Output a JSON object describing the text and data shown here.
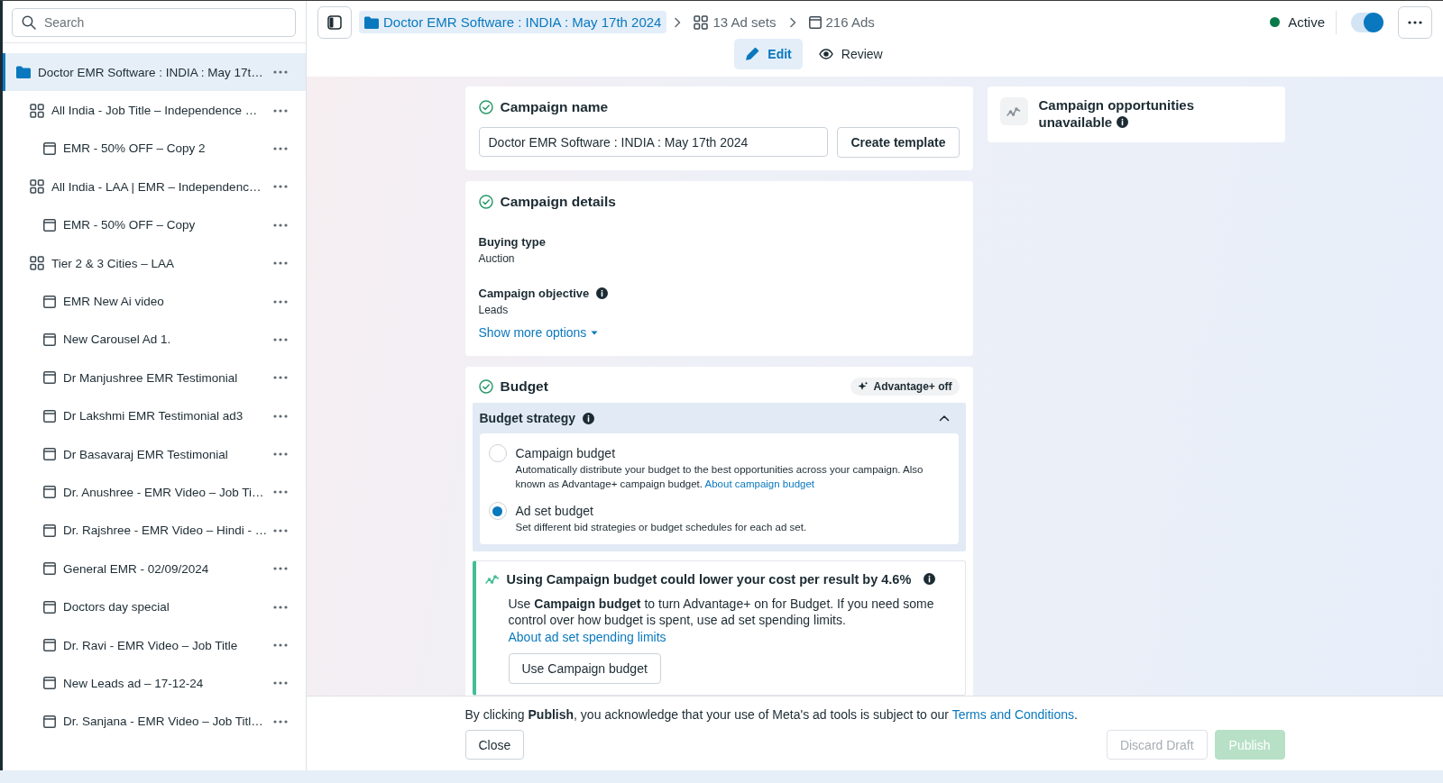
{
  "search": {
    "placeholder": "Search"
  },
  "tree": [
    {
      "kind": "campaign",
      "label": "Doctor EMR Software : INDIA : May 17t…",
      "selected": true,
      "children": [
        {
          "kind": "adset",
          "label": "All India - Job Title – Independence …",
          "selected": false,
          "children": [
            {
              "kind": "ad",
              "label": "EMR - 50% OFF – Copy 2",
              "selected": false
            }
          ]
        },
        {
          "kind": "adset",
          "label": "All India - LAA | EMR – Independenc…",
          "selected": false,
          "children": [
            {
              "kind": "ad",
              "label": "EMR - 50% OFF – Copy",
              "selected": false
            }
          ]
        },
        {
          "kind": "adset",
          "label": "Tier 2 & 3 Cities – LAA",
          "selected": false,
          "children": [
            {
              "kind": "ad",
              "label": "EMR New Ai video",
              "selected": false
            },
            {
              "kind": "ad",
              "label": "New Carousel Ad 1.",
              "selected": false
            },
            {
              "kind": "ad",
              "label": "Dr Manjushree EMR Testimonial",
              "selected": false
            },
            {
              "kind": "ad",
              "label": "Dr Lakshmi EMR Testimonial ad3",
              "selected": false
            },
            {
              "kind": "ad",
              "label": "Dr Basavaraj EMR Testimonial",
              "selected": false
            },
            {
              "kind": "ad",
              "label": "Dr. Anushree - EMR Video – Job Ti…",
              "selected": false
            },
            {
              "kind": "ad",
              "label": "Dr. Rajshree - EMR Video – Hindi - …",
              "selected": false
            },
            {
              "kind": "ad",
              "label": "General EMR - 02/09/2024",
              "selected": false
            },
            {
              "kind": "ad",
              "label": "Doctors day special",
              "selected": false
            },
            {
              "kind": "ad",
              "label": "Dr. Ravi - EMR Video – Job Title",
              "selected": false
            },
            {
              "kind": "ad",
              "label": "New Leads ad – 17-12-24",
              "selected": false
            },
            {
              "kind": "ad",
              "label": "Dr. Sanjana - EMR Video – Job Titl…",
              "selected": false
            }
          ]
        }
      ]
    }
  ],
  "breadcrumbs": [
    {
      "kind": "campaign",
      "label": "Doctor EMR Software : INDIA : May 17th 2024",
      "selected": true
    },
    {
      "kind": "adset",
      "label": "13 Ad sets",
      "selected": false
    },
    {
      "kind": "ad",
      "label": "216 Ads",
      "selected": false
    }
  ],
  "status": {
    "label": "Active",
    "on": true
  },
  "mode_tabs": [
    {
      "kind": "edit",
      "label": "Edit",
      "selected": true
    },
    {
      "kind": "review",
      "label": "Review",
      "selected": false
    }
  ],
  "campaign_name": {
    "title": "Campaign name",
    "complete": true,
    "value": "Doctor EMR Software : INDIA : May 17th 2024",
    "button": "Create template"
  },
  "campaign_details": {
    "title": "Campaign details",
    "complete": true,
    "fields": [
      {
        "label": "Buying type",
        "value": "Auction",
        "info": false
      },
      {
        "label": "Campaign objective",
        "value": "Leads",
        "info": true
      }
    ],
    "more_link": "Show more options"
  },
  "budget": {
    "title": "Budget",
    "complete": true,
    "badge": "Advantage+ off",
    "strategy": {
      "title": "Budget strategy",
      "expanded": true,
      "options": [
        {
          "label": "Campaign budget",
          "description": "Automatically distribute your budget to the best opportunities across your campaign. Also known as Advantage+ campaign budget.",
          "link": "About campaign budget",
          "selected": false
        },
        {
          "label": "Ad set budget",
          "description": "Set different bid strategies or budget schedules for each ad set.",
          "selected": true
        }
      ]
    },
    "recommendation": {
      "title": "Using Campaign budget could lower your cost per result by 4.6%",
      "text": "Use **Campaign budget** to turn Advantage+ on for Budget. If you need some control over how budget is spent, use ad set spending limits.",
      "link": "About ad set spending limits",
      "button": "Use Campaign budget"
    }
  },
  "opportunities": {
    "title": "Campaign opportunities unavailable"
  },
  "footer": {
    "notice": "By clicking **Publish**, you acknowledge that your use of Meta's ad tools is subject to our",
    "link": "Terms and Conditions",
    "notice_end": ".",
    "buttons": [
      {
        "kind": "secondary",
        "label": "Close",
        "disabled": false
      },
      {
        "kind": "secondary",
        "label": "Discard Draft",
        "disabled": true
      },
      {
        "kind": "primary",
        "label": "Publish",
        "disabled": true
      }
    ]
  }
}
